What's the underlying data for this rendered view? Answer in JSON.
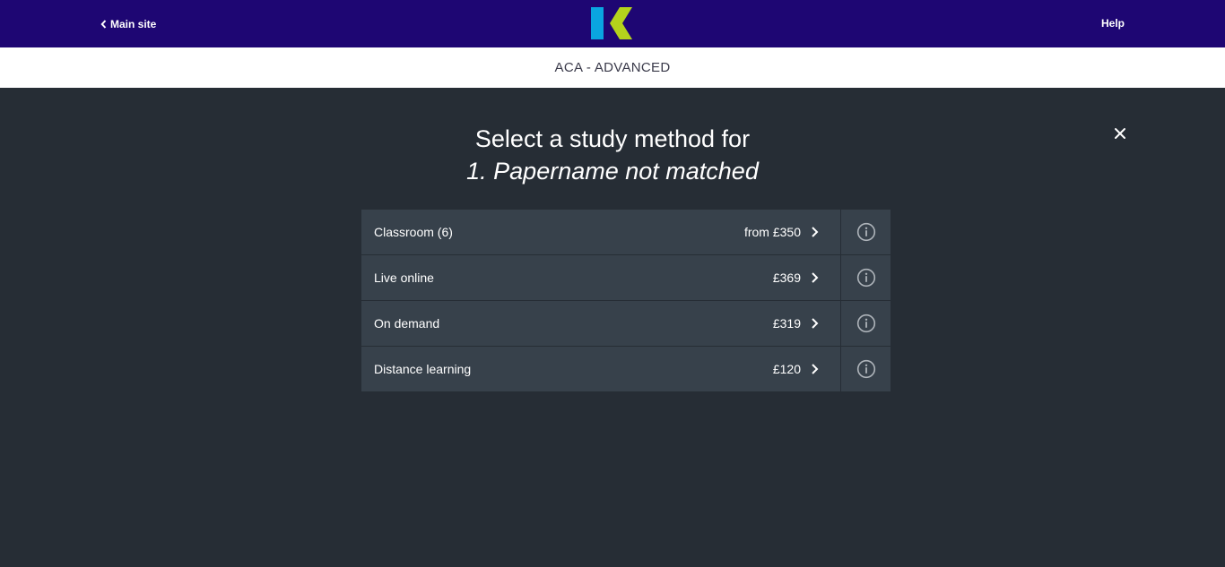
{
  "topbar": {
    "back_label": "Main site",
    "help_label": "Help",
    "brand_colors": {
      "bar": "#1e0673",
      "logo_blue": "#0aa5e0",
      "logo_green": "#b4d31c"
    }
  },
  "subheader": {
    "title": "ACA - ADVANCED"
  },
  "modal": {
    "heading_line1": "Select a study method for",
    "heading_line2": "1. Papername not matched",
    "close_icon": "close-icon"
  },
  "methods": [
    {
      "name": "Classroom (6)",
      "price": "from £350"
    },
    {
      "name": "Live online",
      "price": "£369"
    },
    {
      "name": "On demand",
      "price": "£319"
    },
    {
      "name": "Distance learning",
      "price": "£120"
    }
  ]
}
